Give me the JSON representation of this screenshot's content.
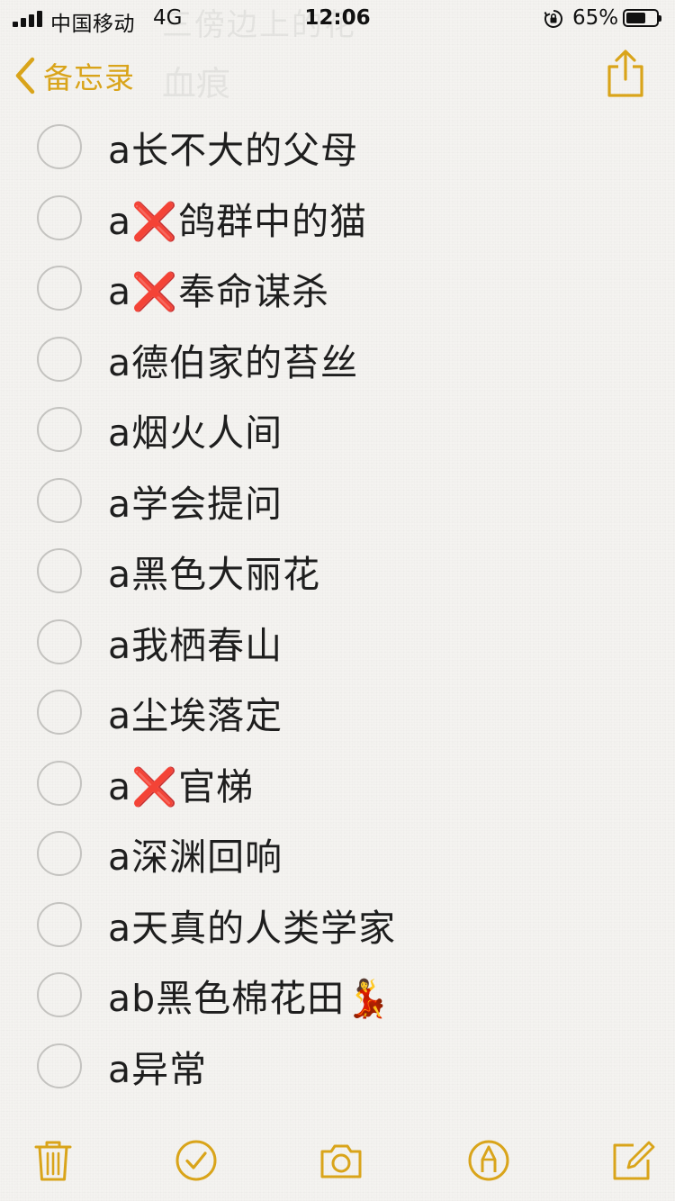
{
  "status_bar": {
    "carrier": "中国移动",
    "network": "4G",
    "time": "12:06",
    "battery_percent": "65%",
    "battery_level": 0.65
  },
  "background": {
    "title_ghost": "三傍边上的花",
    "subtitle_ghost": "血痕"
  },
  "nav": {
    "back_label": "备忘录",
    "share_icon": "share-icon",
    "accent_color": "#d9a41a"
  },
  "checklist": [
    {
      "text": "a长不大的父母",
      "checked": false
    },
    {
      "text": "a❌鸽群中的猫",
      "checked": false
    },
    {
      "text": "a❌奉命谋杀",
      "checked": false
    },
    {
      "text": "a德伯家的苔丝",
      "checked": false
    },
    {
      "text": "a烟火人间",
      "checked": false
    },
    {
      "text": "a学会提问",
      "checked": false
    },
    {
      "text": "a黑色大丽花",
      "checked": false
    },
    {
      "text": "a我栖春山",
      "checked": false
    },
    {
      "text": "a尘埃落定",
      "checked": false
    },
    {
      "text": "a❌官梯",
      "checked": false
    },
    {
      "text": "a深渊回响",
      "checked": false
    },
    {
      "text": "a天真的人类学家",
      "checked": false
    },
    {
      "text": "ab黑色棉花田💃",
      "checked": false
    },
    {
      "text": "a异常",
      "checked": false
    }
  ],
  "toolbar": {
    "icons": [
      "trash-icon",
      "checkmark-circle-icon",
      "camera-icon",
      "markup-pen-icon",
      "compose-icon"
    ]
  }
}
